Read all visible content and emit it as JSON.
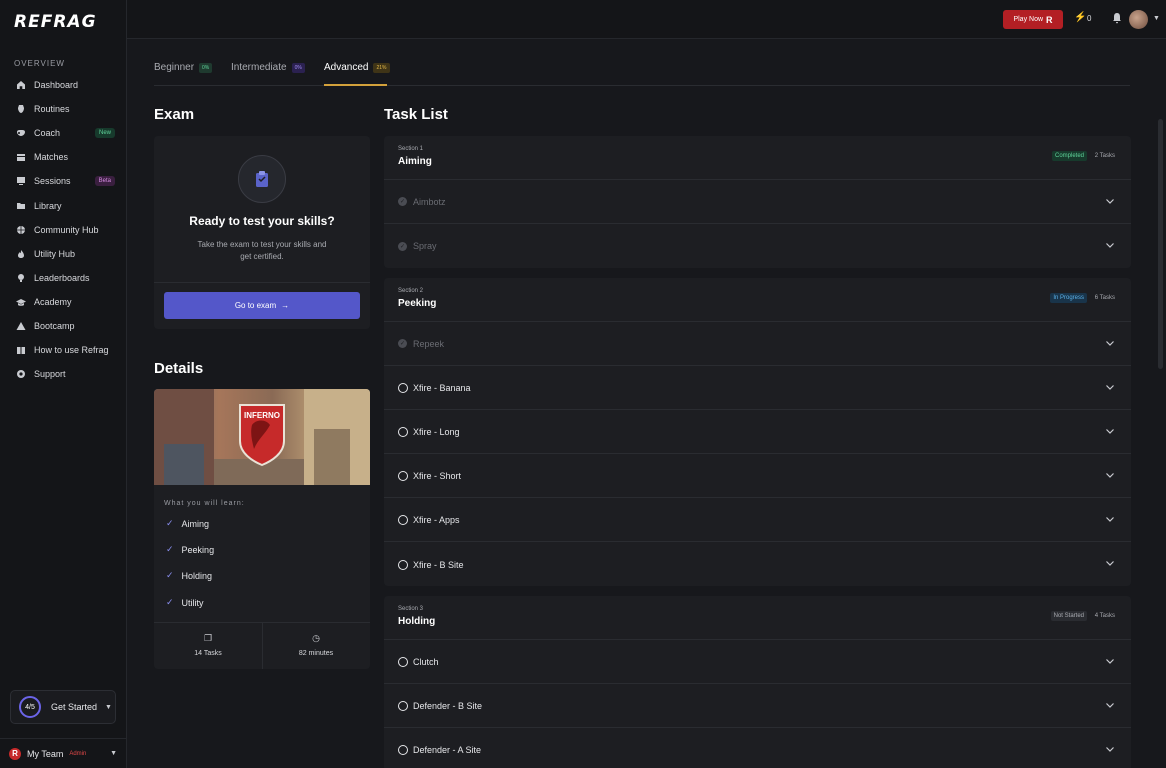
{
  "brand": {
    "logo": "REFRAG"
  },
  "sidebar": {
    "section_title": "OVERVIEW",
    "items": [
      {
        "label": "Dashboard",
        "icon": "home-icon"
      },
      {
        "label": "Routines",
        "icon": "routines-icon"
      },
      {
        "label": "Coach",
        "icon": "coach-icon",
        "badge": "New"
      },
      {
        "label": "Matches",
        "icon": "matches-icon"
      },
      {
        "label": "Sessions",
        "icon": "sessions-icon",
        "badge": "Beta"
      },
      {
        "label": "Library",
        "icon": "folder-icon"
      },
      {
        "label": "Community Hub",
        "icon": "globe-icon"
      },
      {
        "label": "Utility Hub",
        "icon": "flame-icon"
      },
      {
        "label": "Leaderboards",
        "icon": "trophy-icon"
      },
      {
        "label": "Academy",
        "icon": "graduation-icon"
      },
      {
        "label": "Bootcamp",
        "icon": "tent-icon"
      },
      {
        "label": "How to use Refrag",
        "icon": "book-icon"
      },
      {
        "label": "Support",
        "icon": "lifebuoy-icon"
      }
    ],
    "get_started": {
      "progress": "4/5",
      "label": "Get Started"
    },
    "team": {
      "name": "My Team",
      "role": "Admin",
      "logo_letter": "R"
    }
  },
  "topbar": {
    "play_now": "Play Now",
    "play_now_glyph": "R",
    "energy_count": "0"
  },
  "tabs": [
    {
      "label": "Beginner",
      "pct": "0%",
      "active": false
    },
    {
      "label": "Intermediate",
      "pct": "0%",
      "active": false
    },
    {
      "label": "Advanced",
      "pct": "21%",
      "active": true
    }
  ],
  "exam": {
    "heading": "Exam",
    "title": "Ready to test your skills?",
    "description": "Take the exam to test your skills and get certified.",
    "button": "Go to exam",
    "button_arrow": "→"
  },
  "details": {
    "heading": "Details",
    "map_name": "INFERNO",
    "learn_label": "What you will learn:",
    "learn_items": [
      "Aiming",
      "Peeking",
      "Holding",
      "Utility"
    ],
    "tasks_stat": "14 Tasks",
    "minutes_stat": "82 minutes"
  },
  "task_list": {
    "heading": "Task List",
    "sections": [
      {
        "number": "Section 1",
        "name": "Aiming",
        "status": "Completed",
        "count": "2 Tasks",
        "tasks": [
          {
            "name": "Aimbotz",
            "done": true
          },
          {
            "name": "Spray",
            "done": true
          }
        ]
      },
      {
        "number": "Section 2",
        "name": "Peeking",
        "status": "In Progress",
        "count": "6 Tasks",
        "tasks": [
          {
            "name": "Repeek",
            "done": true
          },
          {
            "name": "Xfire - Banana",
            "done": false
          },
          {
            "name": "Xfire - Long",
            "done": false
          },
          {
            "name": "Xfire - Short",
            "done": false
          },
          {
            "name": "Xfire - Apps",
            "done": false
          },
          {
            "name": "Xfire - B Site",
            "done": false
          }
        ]
      },
      {
        "number": "Section 3",
        "name": "Holding",
        "status": "Not Started",
        "count": "4 Tasks",
        "tasks": [
          {
            "name": "Clutch",
            "done": false
          },
          {
            "name": "Defender - B Site",
            "done": false
          },
          {
            "name": "Defender - A Site",
            "done": false
          }
        ]
      }
    ]
  },
  "colors": {
    "accent": "#5457c9",
    "brand_red": "#b31f24",
    "tab_underline": "#d3a13b"
  }
}
